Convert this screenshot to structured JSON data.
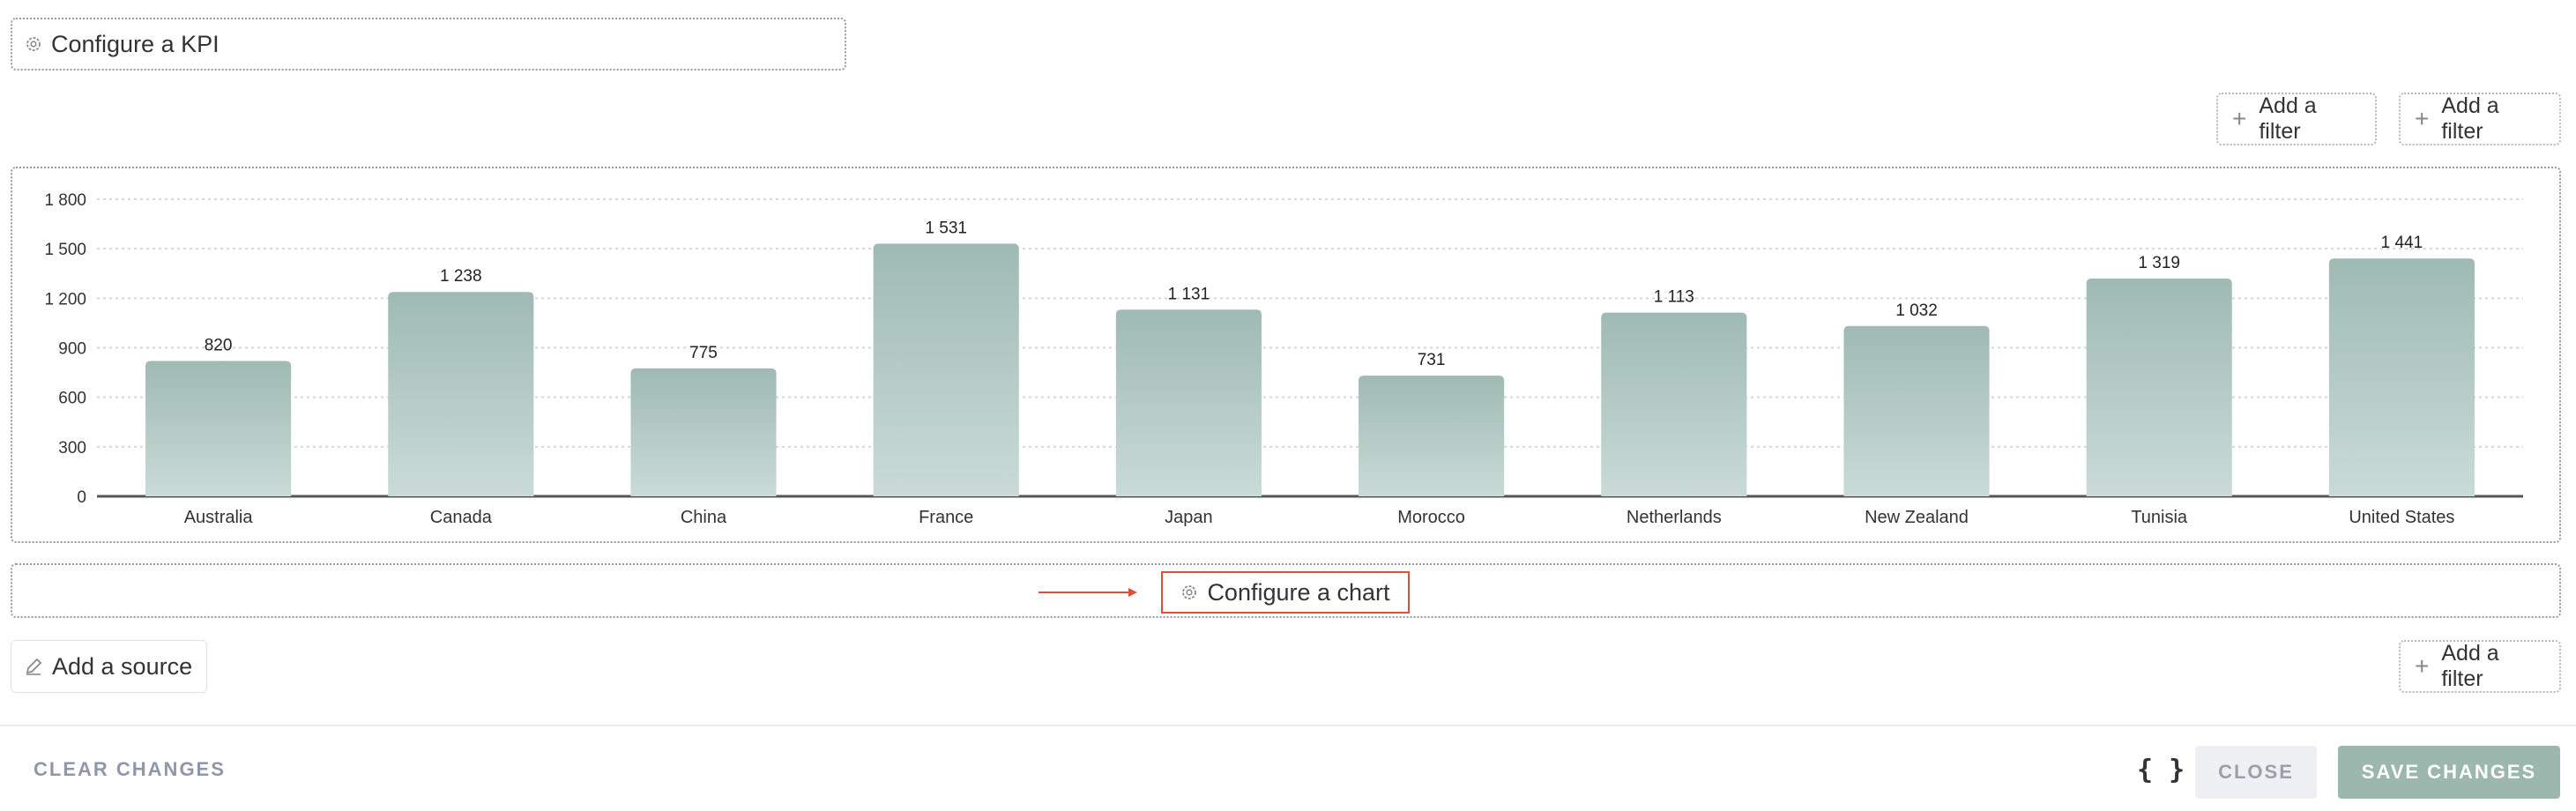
{
  "kpi": {
    "label": "Configure a KPI",
    "icon": "gear-icon"
  },
  "filters": {
    "add_filter_label": "Add a filter",
    "plus_glyph": "+"
  },
  "chart_data": {
    "type": "bar",
    "categories": [
      "Australia",
      "Canada",
      "China",
      "France",
      "Japan",
      "Morocco",
      "Netherlands",
      "New Zealand",
      "Tunisia",
      "United States"
    ],
    "values": [
      820,
      1238,
      775,
      1531,
      1131,
      731,
      1113,
      1032,
      1319,
      1441
    ],
    "value_labels": [
      "820",
      "1 238",
      "775",
      "1 531",
      "1 131",
      "731",
      "1 113",
      "1 032",
      "1 319",
      "1 441"
    ],
    "yticks": [
      0,
      300,
      600,
      900,
      1200,
      1500,
      1800
    ],
    "ytick_labels": [
      "0",
      "300",
      "600",
      "900",
      "1 200",
      "1 500",
      "1 800"
    ],
    "ylim": [
      0,
      1800
    ],
    "grid": true,
    "colors": {
      "bar_top": "#9fbab3",
      "bar_bottom": "#cadbd7",
      "grid": "#d6d6d6",
      "axis": "#555555"
    }
  },
  "chart_config": {
    "label": "Configure a chart",
    "icon": "gear-icon",
    "highlight_color": "#d9503f"
  },
  "source": {
    "label": "Add a source",
    "icon": "pencil-icon"
  },
  "footer": {
    "clear_label": "CLEAR CHANGES",
    "braces_label": "{ }",
    "close_label": "CLOSE",
    "save_label": "SAVE CHANGES"
  }
}
